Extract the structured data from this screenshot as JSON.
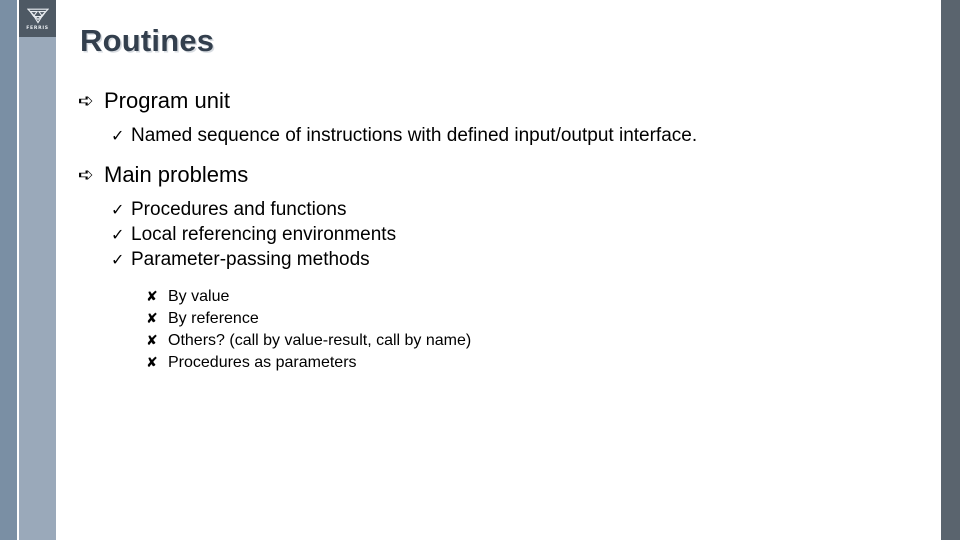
{
  "slide": {
    "title": "Routines",
    "logo": {
      "mark_name": "triangle-chevron-emblem",
      "caption": "FERRIS"
    },
    "bullets": {
      "arrow_glyph": "➪",
      "check_glyph": "✓",
      "cross_glyph": "✘"
    },
    "sections": [
      {
        "heading": "Program unit",
        "items": [
          "Named sequence of instructions with defined input/output interface."
        ]
      },
      {
        "heading": "Main problems",
        "items": [
          "Procedures and functions",
          "Local referencing environments",
          "Parameter-passing methods"
        ],
        "subitems": [
          "By value",
          "By reference",
          "Others? (call by value-result, call by name)",
          "Procedures as parameters"
        ]
      }
    ]
  },
  "colors": {
    "bar_dark": "#7a8fa4",
    "bar_light": "#9aa9ba",
    "bar_right": "#5a646e",
    "logo_bg": "#4e5964",
    "title": "#333f4d",
    "title_shadow": "#d7dbe0",
    "text": "#000000"
  }
}
